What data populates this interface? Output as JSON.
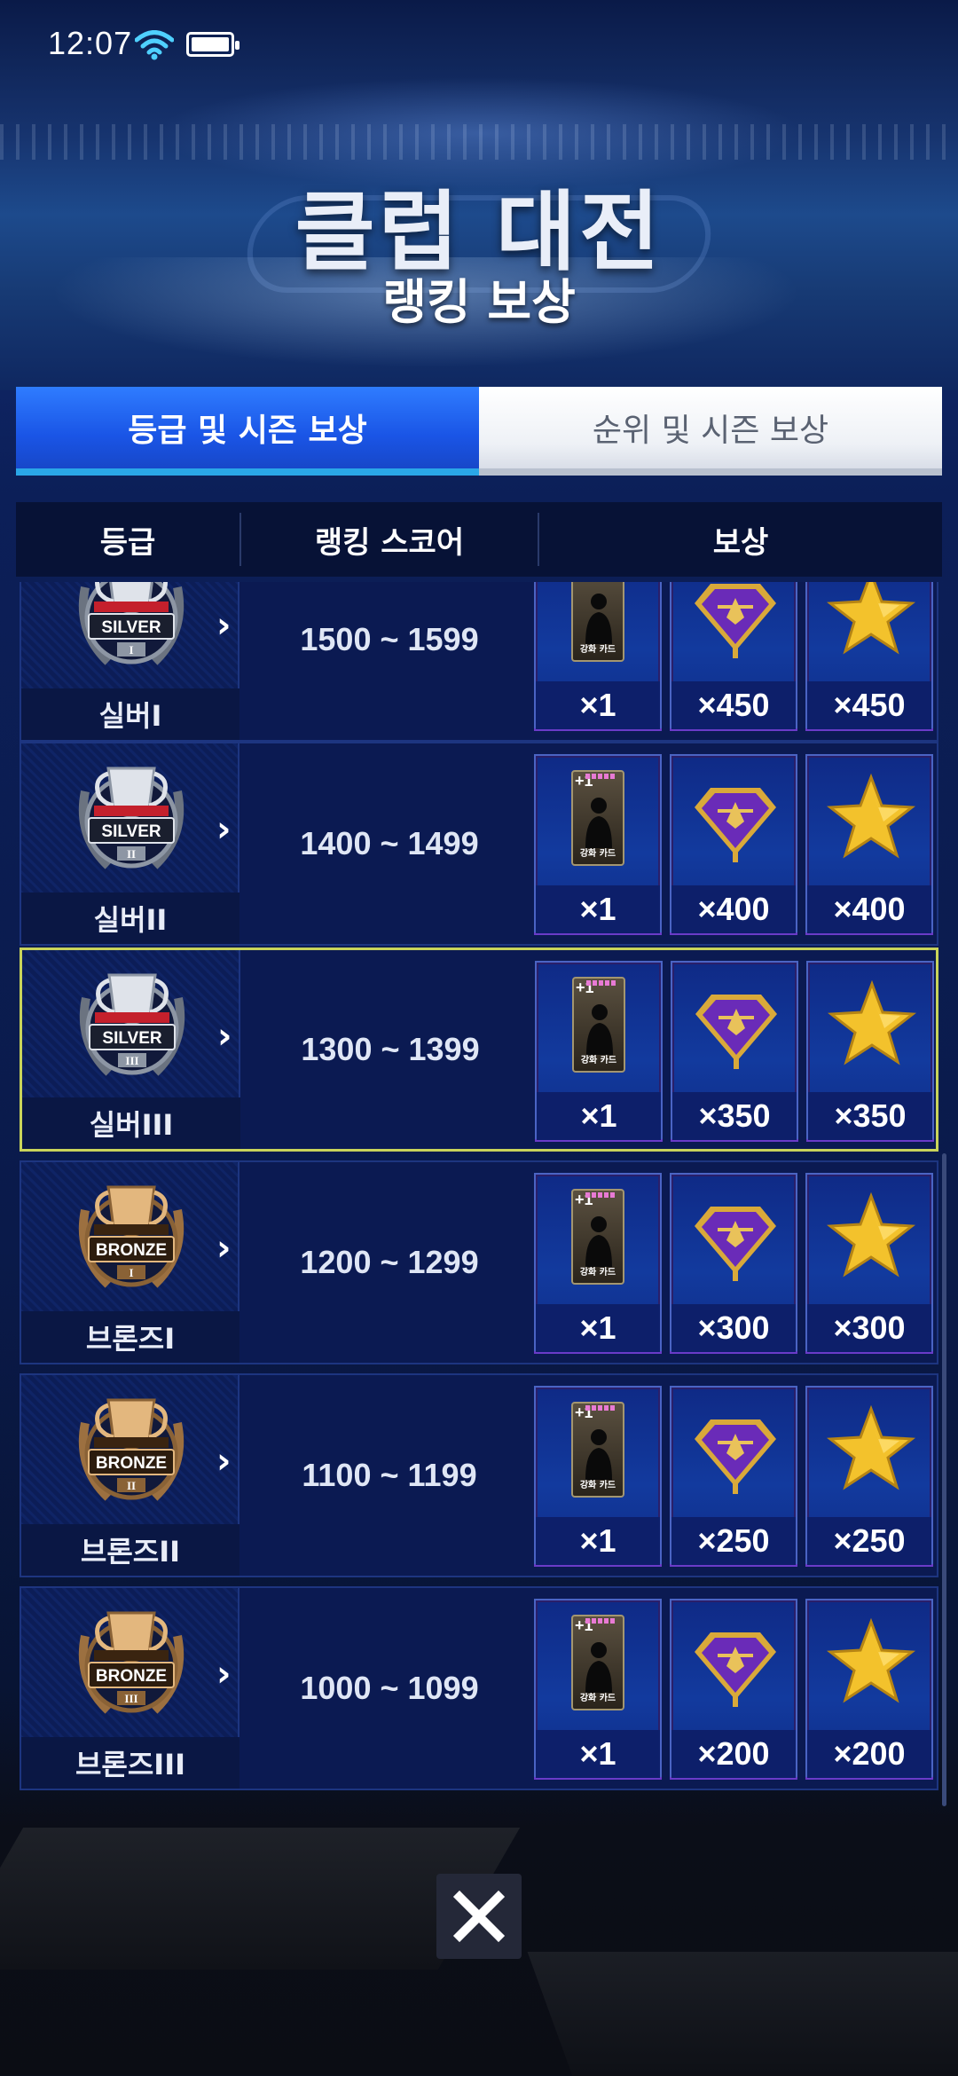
{
  "status_bar": {
    "time": "12:07",
    "wifi_icon": "wifi-icon",
    "battery_icon": "battery-icon"
  },
  "header": {
    "title": "클럽 대전",
    "subtitle": "랭킹 보상"
  },
  "tabs": [
    {
      "label": "등급 및 시즌 보상",
      "active": true
    },
    {
      "label": "순위 및 시즌 보상",
      "active": false
    }
  ],
  "table_header": {
    "grade": "등급",
    "score": "랭킹 스코어",
    "reward": "보상"
  },
  "colors": {
    "silver": "#c9ced6",
    "bronze": "#c79a62",
    "highlight": "#c9d45a",
    "active_tab": "#1f5ef0"
  },
  "rows": [
    {
      "tier": "실버I",
      "badge_text": "SILVER",
      "badge_color": "silver",
      "score": "1500 ~ 1599",
      "rewards": [
        "×1",
        "×450",
        "×450"
      ]
    },
    {
      "tier": "실버II",
      "badge_text": "SILVER",
      "badge_color": "silver",
      "score": "1400 ~ 1499",
      "rewards": [
        "×1",
        "×400",
        "×400"
      ]
    },
    {
      "tier": "실버III",
      "badge_text": "SILVER",
      "badge_color": "silver",
      "score": "1300 ~ 1399",
      "rewards": [
        "×1",
        "×350",
        "×350"
      ],
      "current": true
    },
    {
      "tier": "브론즈I",
      "badge_text": "BRONZE",
      "badge_color": "bronze",
      "score": "1200 ~ 1299",
      "rewards": [
        "×1",
        "×300",
        "×300"
      ]
    },
    {
      "tier": "브론즈II",
      "badge_text": "BRONZE",
      "badge_color": "bronze",
      "score": "1100 ~ 1199",
      "rewards": [
        "×1",
        "×250",
        "×250"
      ]
    },
    {
      "tier": "브론즈III",
      "badge_text": "BRONZE",
      "badge_color": "bronze",
      "score": "1000 ~ 1099",
      "rewards": [
        "×1",
        "×200",
        "×200"
      ]
    }
  ],
  "reward_icons": [
    "enhance-card-icon",
    "purple-gem-icon",
    "gold-star-icon"
  ],
  "card_label": "강화 카드",
  "card_plus": "+1",
  "close_icon": "close-icon"
}
